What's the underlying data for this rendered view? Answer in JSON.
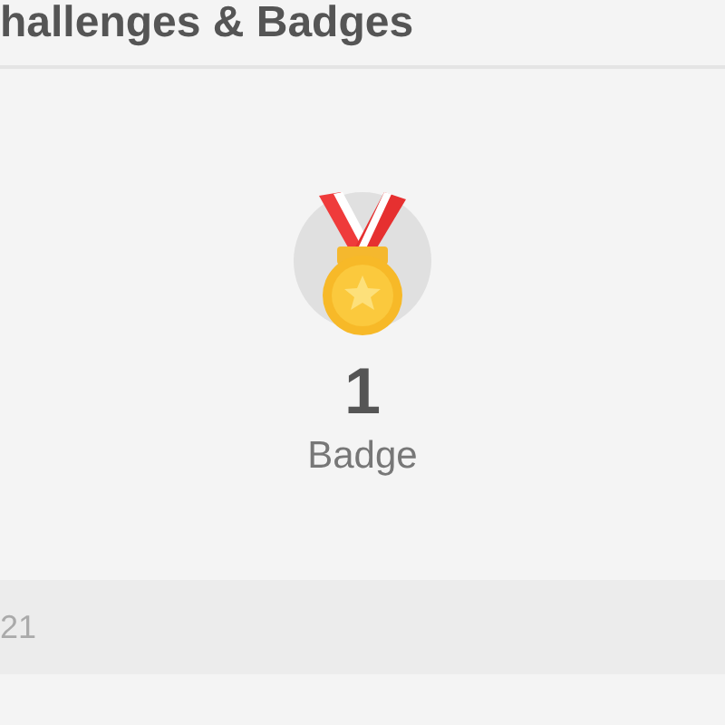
{
  "header": {
    "title": "hallenges & Badges"
  },
  "badges": {
    "count": "1",
    "label": "Badge"
  },
  "section": {
    "label": "21"
  }
}
